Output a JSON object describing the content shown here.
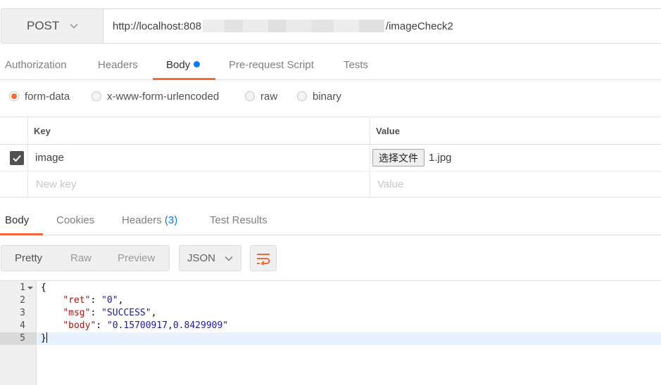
{
  "request": {
    "method": "POST",
    "url_prefix": "http://localhost:808",
    "url_suffix": "/imageCheck2"
  },
  "request_tabs": [
    {
      "label": "Authorization",
      "active": false
    },
    {
      "label": "Headers",
      "active": false
    },
    {
      "label": "Body",
      "active": true,
      "dot": true
    },
    {
      "label": "Pre-request Script",
      "active": false
    },
    {
      "label": "Tests",
      "active": false
    }
  ],
  "body_types": [
    {
      "label": "form-data",
      "selected": true
    },
    {
      "label": "x-www-form-urlencoded",
      "selected": false
    },
    {
      "label": "raw",
      "selected": false
    },
    {
      "label": "binary",
      "selected": false
    }
  ],
  "form_table": {
    "headers": {
      "key": "Key",
      "value": "Value"
    },
    "rows": [
      {
        "checked": true,
        "key": "image",
        "file_button": "选择文件",
        "file_name": "1.jpg"
      }
    ],
    "new_key_placeholder": "New key",
    "new_value_placeholder": "Value"
  },
  "response_tabs": [
    {
      "label": "Body",
      "active": true
    },
    {
      "label": "Cookies",
      "active": false
    },
    {
      "label": "Headers",
      "count": "(3)",
      "active": false
    },
    {
      "label": "Test Results",
      "active": false
    }
  ],
  "view_modes": [
    {
      "label": "Pretty",
      "selected": true
    },
    {
      "label": "Raw",
      "selected": false
    },
    {
      "label": "Preview",
      "selected": false
    }
  ],
  "format": "JSON",
  "code_lines": [
    {
      "n": "1",
      "fold": true
    },
    {
      "n": "2"
    },
    {
      "n": "3"
    },
    {
      "n": "4"
    },
    {
      "n": "5",
      "highlighted": true
    }
  ],
  "response_json": {
    "open_brace": "{",
    "close_brace": "}",
    "fields": [
      {
        "key": "\"ret\"",
        "value": "\"0\"",
        "sep": ": ",
        "trail": ","
      },
      {
        "key": "\"msg\"",
        "value": "\"SUCCESS\"",
        "sep": ": ",
        "trail": ","
      },
      {
        "key": "\"body\"",
        "value": "\"0.15700917,0.8429909\"",
        "sep": ": ",
        "trail": ""
      }
    ]
  },
  "colors": {
    "accent": "#f26b3a",
    "link": "#097bed"
  }
}
